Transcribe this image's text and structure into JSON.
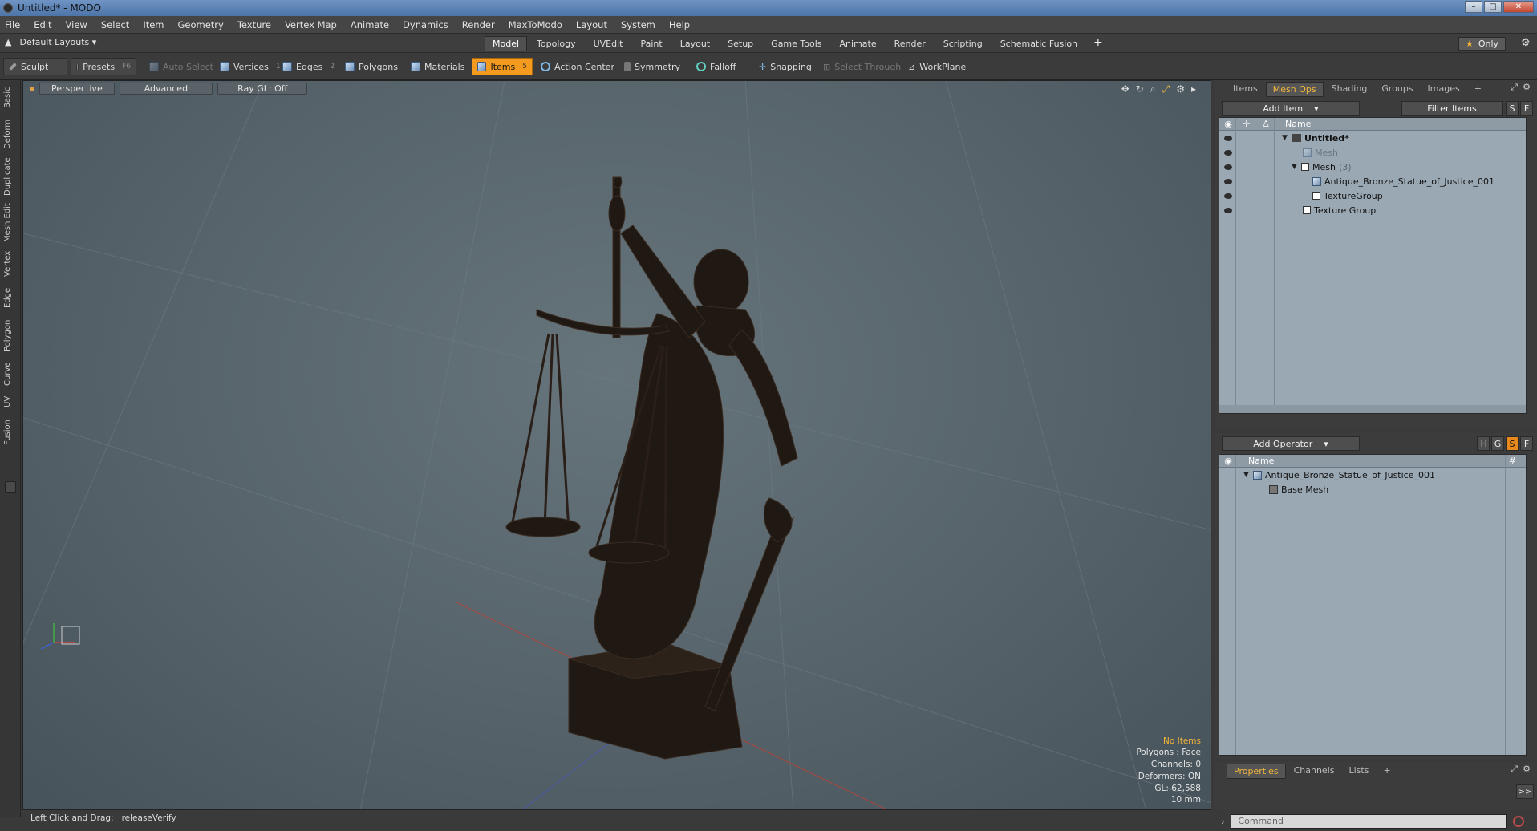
{
  "window": {
    "title": "Untitled* - MODO",
    "buttons": [
      "–",
      "□",
      "✕"
    ]
  },
  "menu": [
    "File",
    "Edit",
    "View",
    "Select",
    "Item",
    "Geometry",
    "Texture",
    "Vertex Map",
    "Animate",
    "Dynamics",
    "Render",
    "MaxToModo",
    "Layout",
    "System",
    "Help"
  ],
  "layout": {
    "name": "Default Layouts",
    "tabs": [
      "Model",
      "Topology",
      "UVEdit",
      "Paint",
      "Layout",
      "Setup",
      "Game Tools",
      "Animate",
      "Render",
      "Scripting",
      "Schematic Fusion"
    ],
    "active_tab": "Model",
    "add_tab": "+",
    "only": "Only"
  },
  "toolbar": {
    "sculpt": "Sculpt",
    "presets": "Presets",
    "presets_key": "F6",
    "auto_select": "Auto Select",
    "vertices": "Vertices",
    "vertices_key": "1",
    "edges": "Edges",
    "edges_key": "2",
    "polygons": "Polygons",
    "materials": "Materials",
    "items": "Items",
    "items_key": "5",
    "action_center": "Action Center",
    "symmetry": "Symmetry",
    "falloff": "Falloff",
    "snapping": "Snapping",
    "select_through": "Select Through",
    "workplane": "WorkPlane"
  },
  "left_tabs": [
    "Basic",
    "Deform",
    "Duplicate",
    "Mesh Edit",
    "Vertex",
    "Edge",
    "Polygon",
    "Curve",
    "UV",
    "Fusion"
  ],
  "viewport": {
    "view": "Perspective",
    "shading": "Advanced",
    "raygl": "Ray GL: Off",
    "stats": {
      "items": "No Items",
      "polygons": "Polygons : Face",
      "channels": "Channels: 0",
      "deformers": "Deformers: ON",
      "gl": "GL: 62,588",
      "grid": "10 mm"
    }
  },
  "status": {
    "hint": "Left Click and Drag:",
    "action": "releaseVerify"
  },
  "items_panel": {
    "tabs": [
      "Items",
      "Mesh Ops",
      "Shading",
      "Groups",
      "Images"
    ],
    "active": "Mesh Ops",
    "add_item": "Add Item",
    "filter": "Filter Items",
    "s": "S",
    "f": "F",
    "col_name": "Name",
    "tree": [
      {
        "label": "Untitled*",
        "level": 0
      },
      {
        "label": "Mesh",
        "level": 1
      },
      {
        "label": "Mesh",
        "count": "(3)",
        "level": 1
      },
      {
        "label": "Antique_Bronze_Statue_of_Justice_001",
        "level": 2
      },
      {
        "label": "TextureGroup",
        "level": 2
      },
      {
        "label": "Texture Group",
        "level": 1
      }
    ]
  },
  "meshops_panel": {
    "add_operator": "Add Operator",
    "h": "H",
    "g": "G",
    "s": "S",
    "f": "F",
    "col_name": "Name",
    "col_hash": "#",
    "tree": [
      {
        "label": "Antique_Bronze_Statue_of_Justice_001"
      },
      {
        "label": "Base Mesh"
      }
    ]
  },
  "props_panel": {
    "tabs": [
      "Properties",
      "Channels",
      "Lists"
    ],
    "active": "Properties",
    "expand": ">>"
  },
  "command": {
    "placeholder": "Command"
  }
}
